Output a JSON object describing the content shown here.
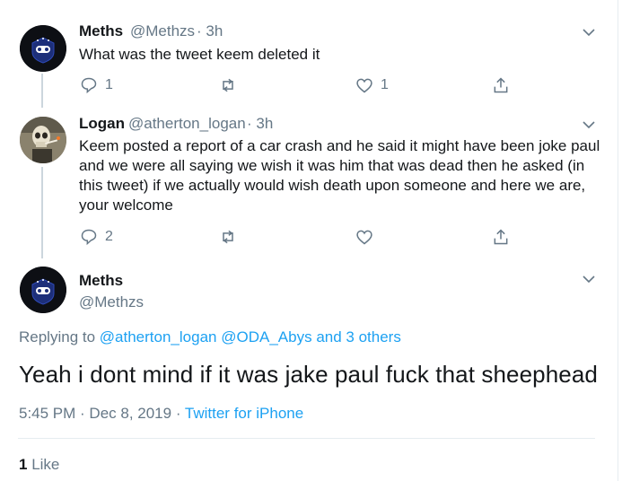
{
  "tweets": [
    {
      "name": "Meths",
      "handle": "@Methzs",
      "time": "· 3h",
      "text": "What was the tweet keem deleted it",
      "reply_count": "1",
      "retweet_count": "",
      "like_count": "1"
    },
    {
      "name": "Logan",
      "handle": "@atherton_logan",
      "time": "· 3h",
      "text_lines": [
        "Keem posted a report of a car crash and he said it might have been joke paul",
        "and we were all saying we wish it was him that was dead then he asked (in",
        "this tweet) if we actually would wish death upon someone and here we are,",
        "your welcome"
      ],
      "reply_count": "2",
      "retweet_count": "",
      "like_count": ""
    }
  ],
  "main_tweet": {
    "name": "Meths",
    "handle": "@Methzs",
    "replying_prefix": "Replying to",
    "replying_user1": "@atherton_logan",
    "replying_user2": "@ODA_Abys",
    "replying_rest": "and 3 others",
    "text": "Yeah i dont mind if it was jake paul fuck that sheephead",
    "timestamp": "5:45 PM · Dec 8, 2019 ·",
    "source": "Twitter for iPhone",
    "like_count": "1",
    "like_label": "Like"
  },
  "colors": {
    "accent": "#1da1f2",
    "secondary_text": "#657786",
    "primary_text": "#14171a",
    "thread_line": "#ccd6dd"
  },
  "icons": [
    "chevron-down-icon",
    "reply-icon",
    "retweet-icon",
    "like-icon",
    "share-icon"
  ]
}
